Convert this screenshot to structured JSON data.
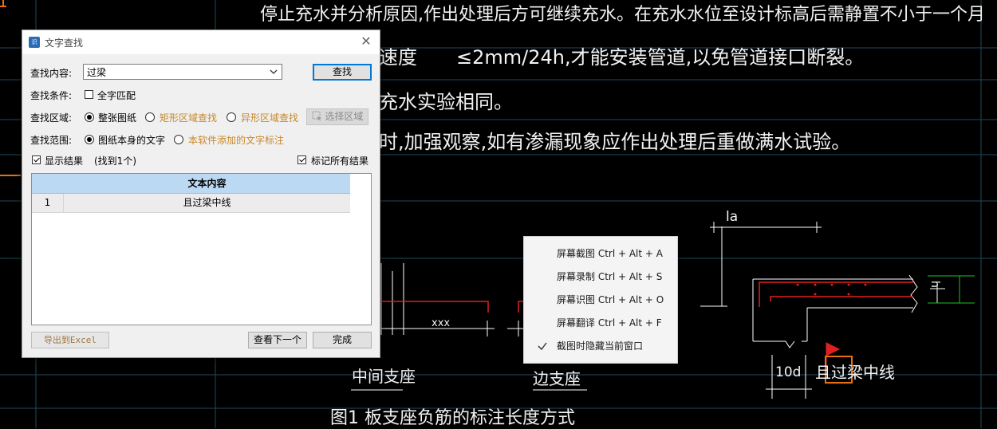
{
  "cad": {
    "line1": "停止充水并分析原因,作出处理后方可继续充水。在充水水位至设计标高后需静置不小于一个月",
    "line2a": "速度",
    "line2b": "≤2mm/24h,才能安装管道,以免管道接口断裂。",
    "line3": "充水实验相同。",
    "line4": "时,加强观察,如有渗漏现象应作出处理后重做满水试验。",
    "label_middle_support": "中间支座",
    "label_edge_support": "边支座",
    "label_xxx": "xxx",
    "label_la": "la",
    "label_10d": "10d",
    "label_h": "h",
    "label_beam_center": "且过梁中线",
    "caption": "图1 板支座负筋的标注长度方式"
  },
  "dialog": {
    "title": "文字查找",
    "icon": "app-logo-icon",
    "find_content_label": "查找内容:",
    "find_value": "过梁",
    "find_button": "查找",
    "condition_label": "查找条件:",
    "whole_word_label": "全字匹配",
    "whole_word_checked": false,
    "area_label": "查找区域:",
    "area_options": [
      "整张图纸",
      "矩形区域查找",
      "异形区域查找"
    ],
    "area_selected": "整张图纸",
    "select_area_button": "选择区域",
    "scope_label": "查找范围:",
    "scope_options": [
      "图纸本身的文字",
      "本软件添加的文字标注"
    ],
    "scope_selected": "图纸本身的文字",
    "show_results_label": "显示结果",
    "show_results_checked": true,
    "found_count_text": "(找到1个)",
    "mark_all_label": "标记所有结果",
    "mark_all_checked": true,
    "table": {
      "header": "文本内容",
      "rows": [
        {
          "index": "1",
          "text": "且过梁中线"
        }
      ]
    },
    "export_button": "导出到Excel",
    "next_button": "查看下一个",
    "done_button": "完成"
  },
  "context_menu": {
    "items": [
      {
        "label": "屏幕截图 Ctrl + Alt + A",
        "checked": false
      },
      {
        "label": "屏幕录制 Ctrl + Alt + S",
        "checked": false
      },
      {
        "label": "屏幕识图 Ctrl + Alt + O",
        "checked": false
      },
      {
        "label": "屏幕翻译 Ctrl + Alt + F",
        "checked": false
      },
      {
        "label": "截图时隐藏当前窗口",
        "checked": true
      }
    ]
  },
  "colors": {
    "cad_background": "#000000",
    "cad_grid": "#1f4a5a",
    "cad_red": "#e02020",
    "cad_green": "#20c020",
    "cad_orange": "#e87010",
    "dialog_accent": "#0078d7",
    "table_header": "#bcd9f3"
  }
}
